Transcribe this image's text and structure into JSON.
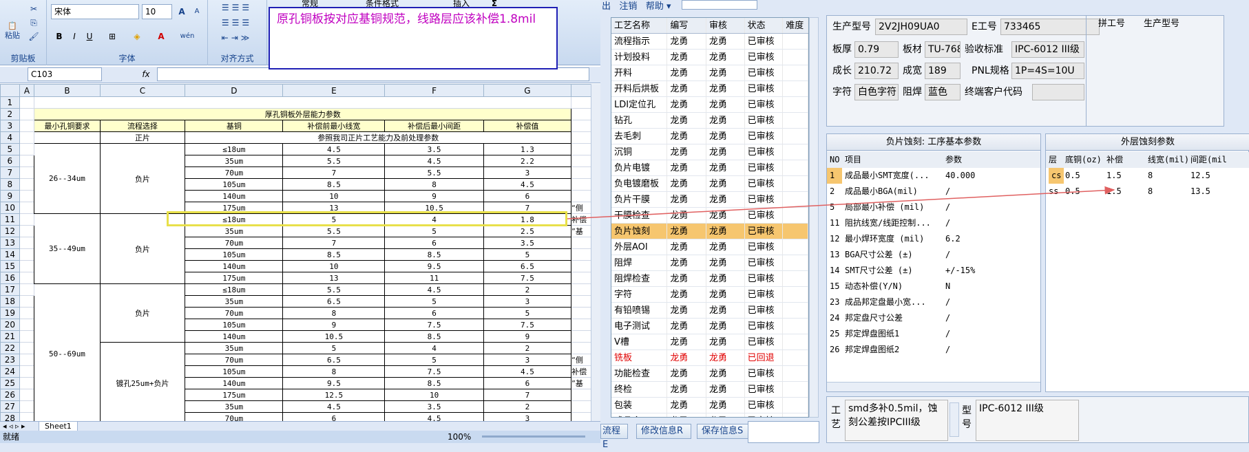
{
  "ribbon": {
    "font_name": "宋体",
    "font_size": "10",
    "grow_font": "A",
    "shrink_font": "A",
    "bold": "B",
    "italic": "I",
    "underline": "U",
    "phonetic": "wén",
    "paste_label": "粘贴",
    "clipboard_label": "剪贴板",
    "font_label": "字体",
    "align_label": "对齐方式",
    "number_format": "常规",
    "cond_format": "条件格式",
    "insert": "插入",
    "sigma": "Σ"
  },
  "formula_bar": {
    "name_box": "C103",
    "fx": "fx"
  },
  "comment": "原孔铜板按对应基铜规范，线路层应该补偿1.8mil",
  "sheet": {
    "col_headers": [
      "A",
      "B",
      "C",
      "D",
      "E",
      "F",
      "G"
    ],
    "row_numbers": [
      "1",
      "2",
      "3",
      "4",
      "5",
      "6",
      "7",
      "8",
      "9",
      "10",
      "11",
      "12",
      "13",
      "14",
      "15",
      "16",
      "17",
      "18",
      "19",
      "20",
      "21",
      "22",
      "23",
      "24",
      "25",
      "26",
      "27",
      "28"
    ],
    "title": "厚孔铜板外层能力参数",
    "headers": [
      "最小孔铜要求",
      "流程选择",
      "基铜",
      "补偿前最小线宽",
      "补偿后最小间距",
      "补偿值"
    ],
    "ref_row": {
      "process": "正片",
      "note": "参照我司正片工艺能力及前处理参数"
    },
    "group1": {
      "range": "26--34um",
      "process": "负片",
      "rows": [
        [
          "≤18um",
          "4.5",
          "3.5",
          "1.3"
        ],
        [
          "35um",
          "5.5",
          "4.5",
          "2.2"
        ],
        [
          "70um",
          "7",
          "5.5",
          "3"
        ],
        [
          "105um",
          "8.5",
          "8",
          "4.5"
        ],
        [
          "140um",
          "10",
          "9",
          "6"
        ],
        [
          "175um",
          "13",
          "10.5",
          "7"
        ]
      ]
    },
    "group2": {
      "range": "35--49um",
      "process": "负片",
      "rows": [
        [
          "≤18um",
          "5",
          "4",
          "1.8"
        ],
        [
          "35um",
          "5.5",
          "5",
          "2.5"
        ],
        [
          "70um",
          "7",
          "6",
          "3.5"
        ],
        [
          "105um",
          "8.5",
          "8.5",
          "5"
        ],
        [
          "140um",
          "10",
          "9.5",
          "6.5"
        ],
        [
          "175um",
          "13",
          "11",
          "7.5"
        ]
      ]
    },
    "group3": {
      "range": "50--69um",
      "process_a": "负片",
      "process_b": "镀孔25um+负片",
      "rows_a": [
        [
          "≤18um",
          "5.5",
          "4.5",
          "2"
        ],
        [
          "35um",
          "6.5",
          "5",
          "3"
        ],
        [
          "70um",
          "8",
          "6",
          "5"
        ],
        [
          "105um",
          "9",
          "7.5",
          "7.5"
        ],
        [
          "140um",
          "10.5",
          "8.5",
          "9"
        ]
      ],
      "rows_b": [
        [
          "35um",
          "5",
          "4",
          "2"
        ],
        [
          "70um",
          "6.5",
          "5",
          "3"
        ],
        [
          "105um",
          "8",
          "7.5",
          "4.5"
        ],
        [
          "140um",
          "9.5",
          "8.5",
          "6"
        ],
        [
          "175um",
          "12.5",
          "10",
          "7"
        ],
        [
          "35um",
          "4.5",
          "3.5",
          "2"
        ],
        [
          "70um",
          "6",
          "4.5",
          "3"
        ]
      ]
    },
    "side_notes": [
      "“侧",
      "补偿",
      "”基"
    ]
  },
  "sheet_tab": "Sheet1",
  "status": {
    "ready": "就绪",
    "zoom": "100%"
  },
  "menu": {
    "items": [
      "出",
      "注销",
      "帮助"
    ]
  },
  "process_list": {
    "headers": [
      "工艺名称",
      "编写",
      "审核",
      "状态",
      "难度"
    ],
    "rows": [
      [
        "流程指示",
        "龙勇",
        "龙勇",
        "已审核"
      ],
      [
        "计划投料",
        "龙勇",
        "龙勇",
        "已审核"
      ],
      [
        "开料",
        "龙勇",
        "龙勇",
        "已审核"
      ],
      [
        "开料后烘板",
        "龙勇",
        "龙勇",
        "已审核"
      ],
      [
        "LDI定位孔",
        "龙勇",
        "龙勇",
        "已审核"
      ],
      [
        "钻孔",
        "龙勇",
        "龙勇",
        "已审核"
      ],
      [
        "去毛刺",
        "龙勇",
        "龙勇",
        "已审核"
      ],
      [
        "沉铜",
        "龙勇",
        "龙勇",
        "已审核"
      ],
      [
        "负片电镀",
        "龙勇",
        "龙勇",
        "已审核"
      ],
      [
        "负电镀磨板",
        "龙勇",
        "龙勇",
        "已审核"
      ],
      [
        "负片干膜",
        "龙勇",
        "龙勇",
        "已审核"
      ],
      [
        "干膜检查",
        "龙勇",
        "龙勇",
        "已审核"
      ],
      [
        "负片蚀刻",
        "龙勇",
        "龙勇",
        "已审核"
      ],
      [
        "外层AOI",
        "龙勇",
        "龙勇",
        "已审核"
      ],
      [
        "阻焊",
        "龙勇",
        "龙勇",
        "已审核"
      ],
      [
        "阻焊检查",
        "龙勇",
        "龙勇",
        "已审核"
      ],
      [
        "字符",
        "龙勇",
        "龙勇",
        "已审核"
      ],
      [
        "有铅喷锡",
        "龙勇",
        "龙勇",
        "已审核"
      ],
      [
        "电子测试",
        "龙勇",
        "龙勇",
        "已审核"
      ],
      [
        "V槽",
        "龙勇",
        "龙勇",
        "已审核"
      ],
      [
        "铣板",
        "龙勇",
        "龙勇",
        "已回退"
      ],
      [
        "功能检查",
        "龙勇",
        "龙勇",
        "已审核"
      ],
      [
        "终检",
        "龙勇",
        "龙勇",
        "已审核"
      ],
      [
        "包装",
        "龙勇",
        "龙勇",
        "已审核"
      ],
      [
        "成品仓",
        "龙勇",
        "龙勇",
        "已审核"
      ]
    ],
    "selected_index": 12,
    "red_index": 20
  },
  "bottom_buttons": [
    "流程E",
    "修改信息R",
    "保存信息S"
  ],
  "info": {
    "model_label": "生产型号",
    "model": "2V2JH09UA0",
    "eid_label": "E工号",
    "eid": "733465",
    "merge_label": "拼工号",
    "merge_model_label": "生产型号",
    "thick_label": "板厚",
    "thick": "0.79",
    "mat_label": "板材",
    "mat": "TU-768",
    "std_label": "验收标准",
    "std": "IPC-6012 III级",
    "len_label": "成长",
    "len": "210.72",
    "wid_label": "成宽",
    "wid": "189",
    "pnl_label": "PNL规格",
    "pnl": "1P=4S=10U",
    "char_label": "字符",
    "char": "白色字符",
    "mask_label": "阻焊",
    "mask": "蓝色",
    "cust_label": "终端客户代码",
    "cust": ""
  },
  "base_params": {
    "title": "负片蚀刻: 工序基本参数",
    "headers": [
      "NO",
      "项目",
      "参数"
    ],
    "rows": [
      [
        "1",
        "成品最小SMT宽度(...",
        "40.000"
      ],
      [
        "2",
        "成品最小BGA(mil)",
        "/"
      ],
      [
        "5",
        "局部最小补偿 (mil)",
        "/"
      ],
      [
        "11",
        "阻抗线宽/线距控制...",
        "/"
      ],
      [
        "12",
        "最小焊环宽度 (mil)",
        "6.2"
      ],
      [
        "13",
        "BGA尺寸公差 (±)",
        "/"
      ],
      [
        "14",
        "SMT尺寸公差 (±)",
        "+/-15%"
      ],
      [
        "15",
        "动态补偿(Y/N)",
        "N"
      ],
      [
        "23",
        "成品邦定盘最小宽...",
        "/"
      ],
      [
        "24",
        "邦定盘尺寸公差",
        "/"
      ],
      [
        "25",
        "邦定焊盘图纸1",
        "/"
      ],
      [
        "26",
        "邦定焊盘图纸2",
        "/"
      ]
    ]
  },
  "etch_params": {
    "title": "外层蚀刻参数",
    "headers": [
      "层",
      "底铜(oz)",
      "补偿",
      "线宽(mil)",
      "间距(mil"
    ],
    "rows": [
      [
        "cs",
        "0.5",
        "1.5",
        "8",
        "12.5"
      ],
      [
        "ss",
        "0.5",
        "1.5",
        "8",
        "13.5"
      ]
    ]
  },
  "notes": {
    "proc_label": "工艺",
    "text": "smd多补0.5mil，蚀刻公差按IPCIII级",
    "type_label": "型号",
    "type_text": "IPC-6012 III级"
  },
  "colors": {
    "selected_row": "#f6c66f",
    "highlight_box": "#e8e04a",
    "comment_border": "#1f1fb5",
    "comment_text": "#c000c0",
    "arrow": "#e06060"
  }
}
